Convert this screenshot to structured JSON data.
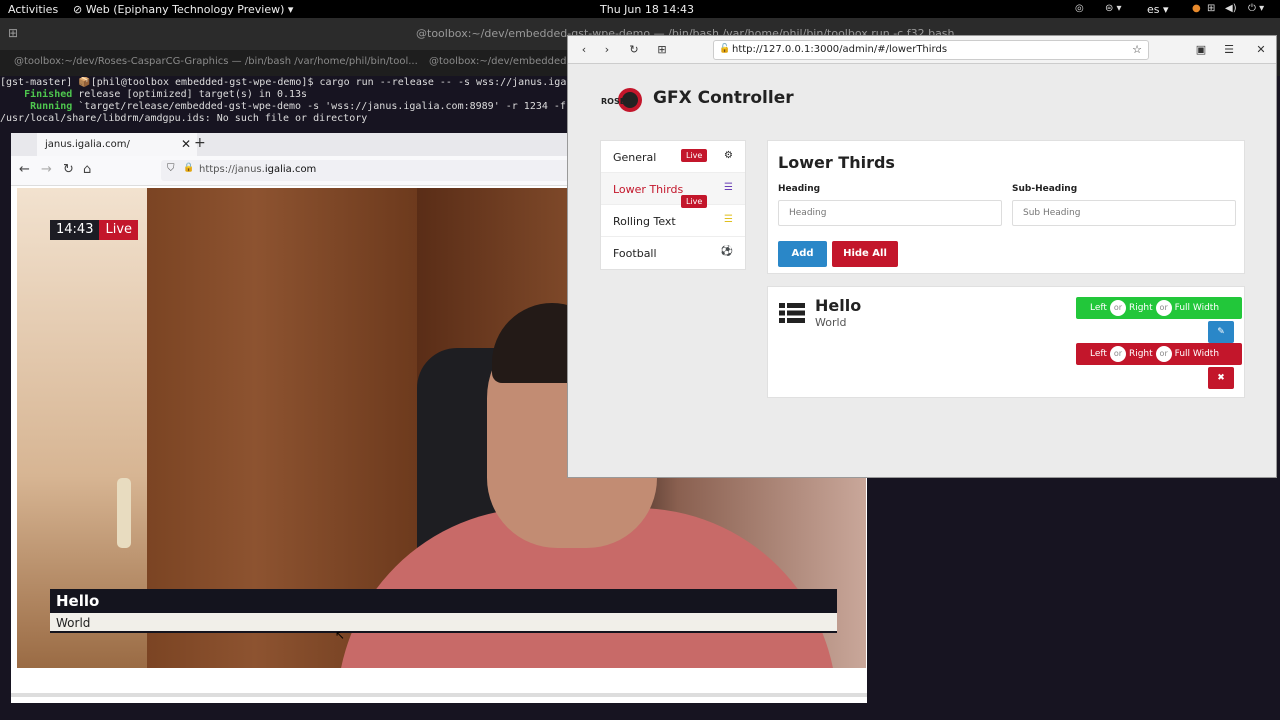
{
  "topbar": {
    "activities": "Activities",
    "app_menu": "Web (Epiphany Technology Preview)",
    "clock": "Thu Jun 18  14:43",
    "lang": "es"
  },
  "terminal": {
    "header_title": "@toolbox:~/dev/embedded-gst-wpe-demo — /bin/bash /var/home/phil/bin/toolbox run -c f32 bash",
    "tabs": [
      "@toolbox:~/dev/Roses-CasparCG-Graphics — /bin/bash /var/home/phil/bin/tool...",
      "@toolbox:~/dev/embedded-gst-wpe-demo"
    ],
    "lines": [
      "[gst-master] 📦[phil@toolbox embedded-gst-wpe-demo]$ cargo run --release -- -s wss://janus.igali",
      "    Finished release [optimized] target(s) in 0.13s",
      "     Running `target/release/embedded-gst-wpe-demo -s 'wss://janus.igalia.com:8989' -r 1234 -f",
      "/usr/local/share/libdrm/amdgpu.ids: No such file or directory"
    ],
    "finished_word": "Finished",
    "running_word": "Running"
  },
  "firefox": {
    "tab_title": "janus.igalia.com/",
    "url_prefix": "https://janus.",
    "url_domain": "igalia.com"
  },
  "video": {
    "time": "14:43",
    "live": "Live",
    "lower_third_heading": "Hello",
    "lower_third_subheading": "World"
  },
  "epiphany": {
    "url": "http://127.0.0.1:3000/admin/#/lowerThirds",
    "app_title": "GFX Controller",
    "logo_text": "ROSES",
    "sidebar": [
      {
        "label": "General",
        "badge": "Live"
      },
      {
        "label": "Lower Thirds",
        "badge": "Live"
      },
      {
        "label": "Rolling Text",
        "badge": ""
      },
      {
        "label": "Football",
        "badge": ""
      }
    ],
    "form": {
      "title": "Lower Thirds",
      "heading_label": "Heading",
      "heading_placeholder": "Heading",
      "subheading_label": "Sub-Heading",
      "subheading_placeholder": "Sub Heading",
      "add_label": "Add",
      "hide_all_label": "Hide All"
    },
    "item": {
      "title": "Hello",
      "subtitle": "World",
      "show_left": "Left",
      "show_right": "Right",
      "show_full": "Full Width",
      "hide_left": "Left",
      "hide_right": "Right",
      "hide_full": "Full Width",
      "or": "or",
      "edit_icon": "edit-icon",
      "delete_icon": "close-icon"
    },
    "colors": {
      "primary": "#2a87c8",
      "danger": "#c3162b",
      "success": "#22c73a"
    }
  }
}
